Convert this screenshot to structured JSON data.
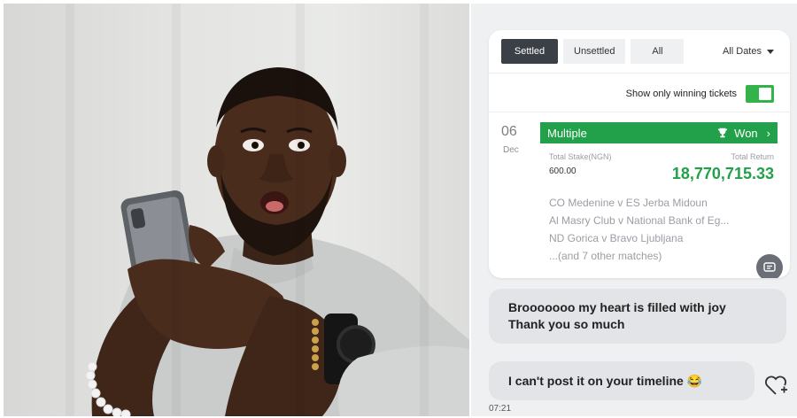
{
  "photo": {
    "description_icon": "man-looking-at-phone-photo"
  },
  "bet_card": {
    "tabs": [
      {
        "label": "Settled",
        "active": true
      },
      {
        "label": "Unsettled",
        "active": false
      },
      {
        "label": "All",
        "active": false
      }
    ],
    "date_filter": "All Dates",
    "toggle_label": "Show only winning tickets",
    "toggle_on": true,
    "ticket": {
      "day": "06",
      "month": "Dec",
      "type": "Multiple",
      "status": "Won",
      "stake_label": "Total Stake(NGN)",
      "stake_value": "600.00",
      "return_label": "Total Return",
      "return_value": "18,770,715.33",
      "matches": [
        "CO Medenine v ES Jerba Midoun",
        "Al Masry Club v National Bank of Eg...",
        "ND Gorica v Bravo Ljubljana",
        "...(and 7 other matches)"
      ]
    }
  },
  "chat": {
    "message1_line1": "Brooooooo my heart is filled with joy",
    "message1_line2": "Thank you so much",
    "message2": "I can't post it on your timeline 😂",
    "time": "07:21"
  },
  "colors": {
    "win_green": "#23a04a",
    "toggle_green": "#33b34a",
    "tab_active": "#3b3f46"
  }
}
